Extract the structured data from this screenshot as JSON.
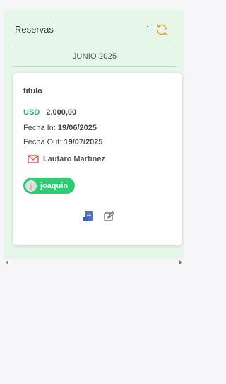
{
  "header": {
    "title": "Reservas",
    "count": "1",
    "refresh_icon": "refresh-icon"
  },
  "month_label": "JUNIO 2025",
  "card": {
    "title": "titulo",
    "currency": "USD",
    "amount": "2.000,00",
    "checkin_label": "Fecha In:",
    "checkin_value": "19/06/2025",
    "checkout_label": "Fecha Out:",
    "checkout_value": "19/07/2025",
    "contact_name": "Lautaro Martinez",
    "contact_icon": "mail-icon",
    "user_chip": {
      "initial": "j",
      "name": "joaquin"
    },
    "actions": [
      {
        "icon": "document-icon"
      },
      {
        "icon": "edit-icon"
      }
    ]
  },
  "colors": {
    "panel_bg": "#e6f7ea",
    "accent_green": "#27b163",
    "chip_green": "#2ecc71",
    "refresh_orange": "#f0a030",
    "mail_red": "#e05555",
    "doc_blue": "#4a72c8"
  }
}
